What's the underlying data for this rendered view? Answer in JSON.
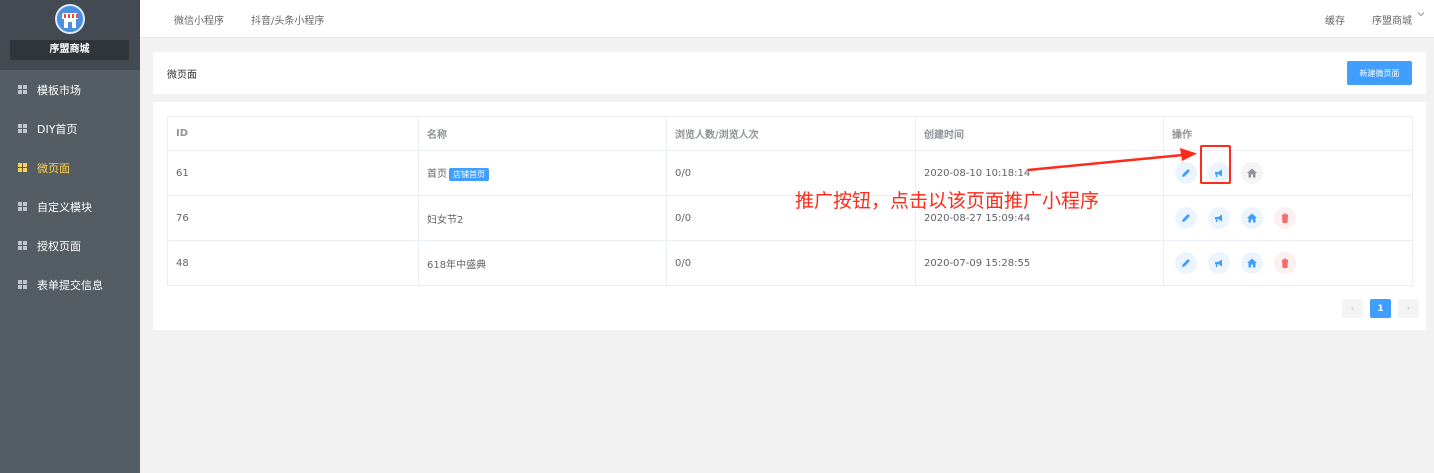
{
  "sidebar": {
    "store_name": "序盟商城",
    "items": [
      {
        "label": "模板市场",
        "active": false
      },
      {
        "label": "DIY首页",
        "active": false
      },
      {
        "label": "微页面",
        "active": true
      },
      {
        "label": "自定义模块",
        "active": false
      },
      {
        "label": "授权页面",
        "active": false
      },
      {
        "label": "表单提交信息",
        "active": false
      }
    ]
  },
  "topbar": {
    "tabs": [
      "微信小程序",
      "抖音/头条小程序"
    ],
    "cache": "缓存",
    "user": "序盟商城",
    "dropdown_icon": "chevron-down-icon"
  },
  "page": {
    "title": "微页面",
    "new_button": "新建微页面"
  },
  "table": {
    "headers": [
      "ID",
      "名称",
      "浏览人数/浏览人次",
      "创建时间",
      "操作"
    ],
    "rows": [
      {
        "id": "61",
        "name": "首页",
        "tag": "店铺首页",
        "views": "0/0",
        "created": "2020-08-10 10:18:14"
      },
      {
        "id": "76",
        "name": "妇女节2",
        "tag": "",
        "views": "0/0",
        "created": "2020-08-27 15:09:44"
      },
      {
        "id": "48",
        "name": "618年中盛典",
        "tag": "",
        "views": "0/0",
        "created": "2020-07-09 15:28:55"
      }
    ]
  },
  "annotation": "推广按钮，点击以该页面推广小程序",
  "pagination": {
    "prev": "‹",
    "current": "1",
    "next": "›"
  },
  "colors": {
    "primary": "#409eff",
    "danger": "#f56c6c",
    "sidebar": "#545c64",
    "active_menu": "#ffd04b",
    "annotation": "#ff2a1a"
  }
}
